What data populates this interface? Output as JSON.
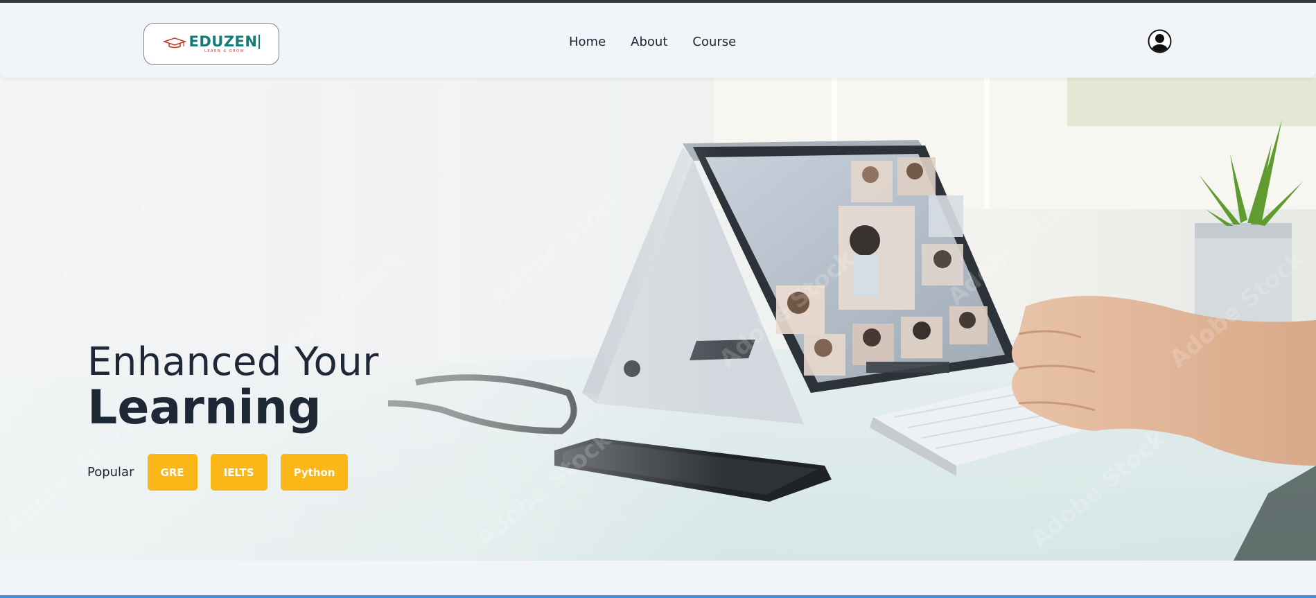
{
  "navbar": {
    "logo": {
      "word": "EDUZEN",
      "tagline": "LEARN & GROW",
      "icon": "graduation-cap-icon"
    },
    "links": [
      {
        "label": "Home"
      },
      {
        "label": "About"
      },
      {
        "label": "Course"
      }
    ],
    "profile_icon": "user-circle-icon"
  },
  "hero": {
    "headline_line1": "Enhanced Your",
    "headline_line2": "Learning",
    "popular_label": "Popular",
    "tags": [
      {
        "label": "GRE"
      },
      {
        "label": "IELTS"
      },
      {
        "label": "Python"
      }
    ],
    "background_description_icon": "laptop-video-call-photo"
  },
  "colors": {
    "accent": "#fbb617",
    "text_dark": "#1e2836",
    "brand": "#157a78",
    "page_bg": "#f1f4f8",
    "bottom_bar": "#3b8fe0"
  }
}
